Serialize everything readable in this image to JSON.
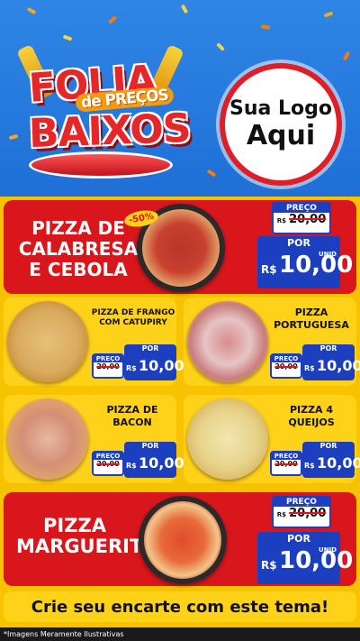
{
  "header": {
    "title_line1": "FOLIA",
    "title_line2": "de PREÇOS",
    "title_line3": "BAIXOS",
    "logo_line1": "Sua Logo",
    "logo_line2": "Aqui"
  },
  "colors": {
    "red": "#d8161c",
    "yellow": "#ffd21a",
    "blue": "#1c3fbf",
    "sky": "#2f86e6"
  },
  "labels": {
    "preco": "PREÇO",
    "por": "POR",
    "currency": "R$",
    "unid": "UNID"
  },
  "products": {
    "calabresa": {
      "name": "PIZZA DE\nCALABRESA\nE CEBOLA",
      "old_price": "20,00",
      "new_price": "10,00",
      "discount": "-50%"
    },
    "frango": {
      "name": "PIZZA DE FRANGO\nCOM CATUPIRY",
      "old_price": "20,00",
      "new_price": "10,00"
    },
    "portuguesa": {
      "name": "PIZZA\nPORTUGUESA",
      "old_price": "20,00",
      "new_price": "10,00"
    },
    "bacon": {
      "name": "PIZZA DE\nBACON",
      "old_price": "20,00",
      "new_price": "10,00"
    },
    "queijos": {
      "name": "PIZZA 4\nQUEIJOS",
      "old_price": "20,00",
      "new_price": "10,00"
    },
    "marguerita": {
      "name": "PIZZA\nMARGUERITA",
      "old_price": "20,00",
      "new_price": "10,00"
    }
  },
  "footer": {
    "cta": "Crie seu encarte com este tema!",
    "disclaimer": "*Imagens Meramente Ilustrativas"
  }
}
